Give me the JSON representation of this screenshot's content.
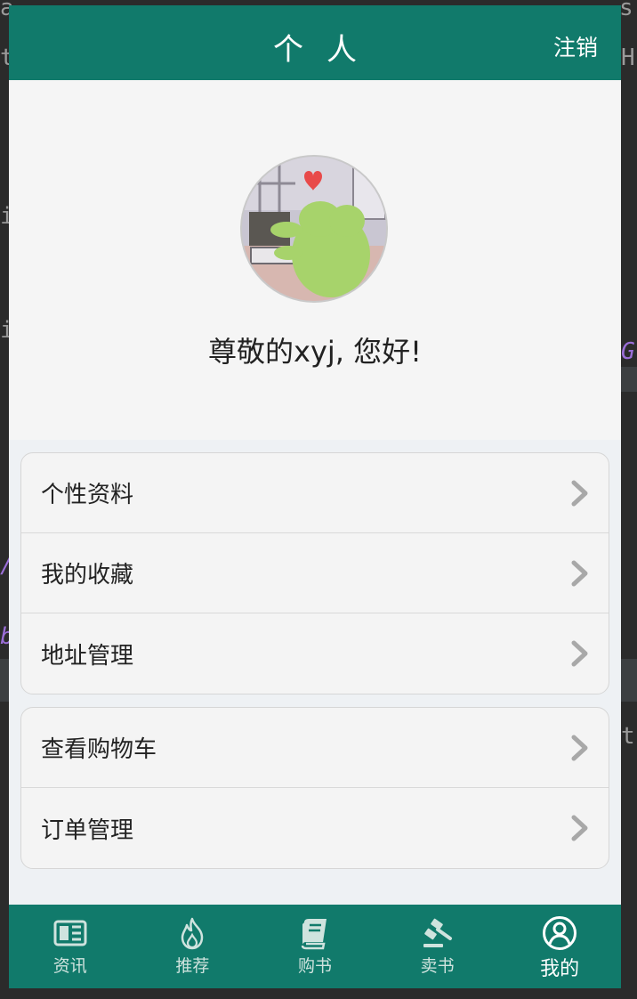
{
  "header": {
    "title": "个人",
    "logout_label": "注销"
  },
  "profile": {
    "greeting": "尊敬的xyj, 您好!"
  },
  "menu_groups": [
    {
      "items": [
        {
          "label": "个性资料"
        },
        {
          "label": "我的收藏"
        },
        {
          "label": "地址管理"
        }
      ]
    },
    {
      "items": [
        {
          "label": "查看购物车"
        },
        {
          "label": "订单管理"
        }
      ]
    }
  ],
  "tabbar": {
    "tabs": [
      {
        "label": "资讯",
        "icon": "news-icon"
      },
      {
        "label": "推荐",
        "icon": "flame-icon"
      },
      {
        "label": "购书",
        "icon": "book-icon"
      },
      {
        "label": "卖书",
        "icon": "gavel-icon"
      },
      {
        "label": "我的",
        "icon": "user-icon",
        "active": true
      }
    ]
  },
  "colors": {
    "accent": "#117a6b",
    "background": "#eef1f4",
    "card": "#f4f4f4"
  }
}
